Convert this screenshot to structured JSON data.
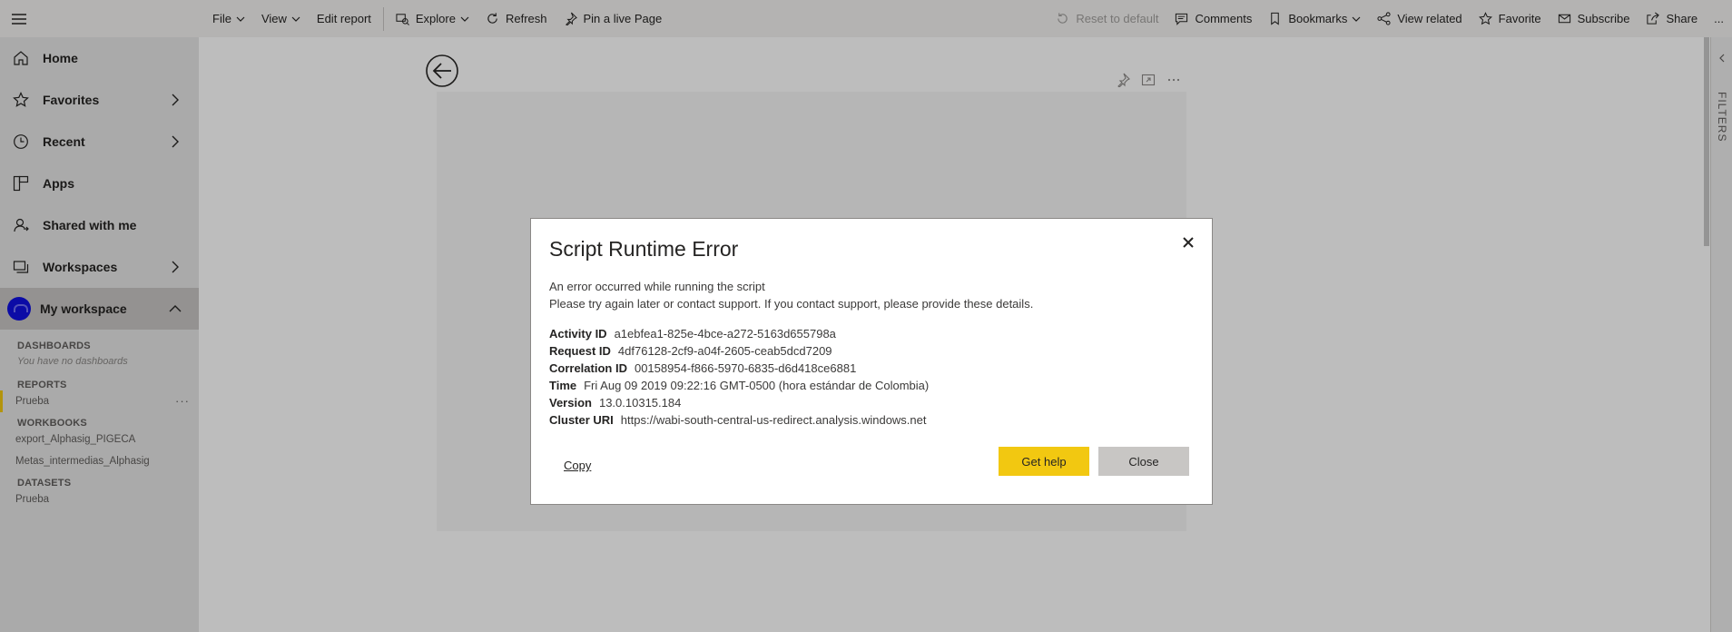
{
  "toolbar": {
    "left": [
      {
        "label": "File",
        "icon": "file-icon"
      },
      {
        "label": "View",
        "icon": "view-icon"
      },
      {
        "label": "Edit report",
        "icon": "edit-report-icon"
      },
      {
        "label": "Explore",
        "icon": "explore-icon"
      },
      {
        "label": "Refresh",
        "icon": "refresh-icon"
      },
      {
        "label": "Pin a live Page",
        "icon": "pin-icon"
      }
    ],
    "right": [
      {
        "label": "Reset to default",
        "icon": "reset-icon"
      },
      {
        "label": "Comments",
        "icon": "comment-icon"
      },
      {
        "label": "Bookmarks",
        "icon": "bookmark-icon"
      },
      {
        "label": "View related",
        "icon": "view-related-icon"
      },
      {
        "label": "Favorite",
        "icon": "star-icon"
      },
      {
        "label": "Subscribe",
        "icon": "mail-icon"
      },
      {
        "label": "Share",
        "icon": "share-icon"
      },
      {
        "label": "...",
        "icon": "more-icon"
      }
    ]
  },
  "sidebar": {
    "nav": [
      {
        "label": "Home",
        "icon": "home-icon"
      },
      {
        "label": "Favorites",
        "icon": "star-icon"
      },
      {
        "label": "Recent",
        "icon": "clock-icon"
      },
      {
        "label": "Apps",
        "icon": "apps-icon"
      },
      {
        "label": "Shared with me",
        "icon": "shared-icon"
      },
      {
        "label": "Workspaces",
        "icon": "workspaces-icon"
      },
      {
        "label": "My workspace",
        "icon": "avatar"
      }
    ],
    "workspace": {
      "dashboards_title": "DASHBOARDS",
      "dashboards_empty": "You have no dashboards",
      "reports_title": "REPORTS",
      "reports": [
        "Prueba"
      ],
      "workbooks_title": "WORKBOOKS",
      "workbooks": [
        "export_Alphasig_PIGECA",
        "Metas_intermedias_Alphasig"
      ],
      "datasets_title": "DATASETS",
      "datasets": [
        "Prueba"
      ]
    }
  },
  "filters_pane": {
    "label": "FILTERS"
  },
  "dialog": {
    "title": "Script Runtime Error",
    "message_line1": "An error occurred while running the script",
    "message_line2": "Please try again later or contact support. If you contact support, please provide these details.",
    "details": [
      {
        "label": "Activity ID",
        "value": "a1ebfea1-825e-4bce-a272-5163d655798a"
      },
      {
        "label": "Request ID",
        "value": "4df76128-2cf9-a04f-2605-ceab5dcd7209"
      },
      {
        "label": "Correlation ID",
        "value": "00158954-f866-5970-6835-d6d418ce6881"
      },
      {
        "label": "Time",
        "value": "Fri Aug 09 2019 09:22:16 GMT-0500 (hora estándar de Colombia)"
      },
      {
        "label": "Version",
        "value": "13.0.10315.184"
      },
      {
        "label": "Cluster URI",
        "value": "https://wabi-south-central-us-redirect.analysis.windows.net"
      }
    ],
    "copy_label": "Copy",
    "get_help_label": "Get help",
    "close_label": "Close"
  },
  "colors": {
    "accent_yellow": "#f2c811",
    "avatar_blue": "#1010e0"
  }
}
